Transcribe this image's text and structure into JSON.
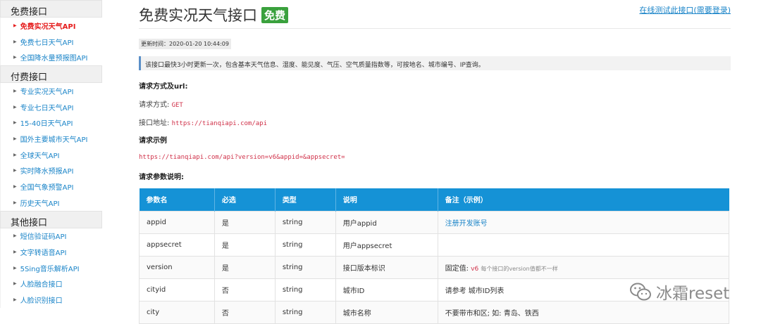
{
  "sidebar": {
    "groups": [
      {
        "title": "免费接口",
        "items": [
          "免费实况天气API",
          "免费七日天气API",
          "全国降水量预报图API"
        ]
      },
      {
        "title": "付费接口",
        "items": [
          "专业实况天气API",
          "专业七日天气API",
          "15-40日天气API",
          "国外主要城市天气API",
          "全球天气API",
          "实时降水预报API",
          "全国气象预警API",
          "历史天气API"
        ]
      },
      {
        "title": "其他接口",
        "items": [
          "短信验证码API",
          "文字转语音API",
          "5Sing音乐解析API",
          "人脸融合接口",
          "人脸识别接口"
        ]
      }
    ],
    "active_item": "免费实况天气API"
  },
  "page": {
    "title": "免费实况天气接口",
    "badge": "免费",
    "test_link": "在线测试此接口(需要登录)",
    "update_time": "更新时间：2020-01-20 10:44:09",
    "notice": "该接口最快3小时更新一次，包含基本天气信息、湿度、能见度、气压、空气质量指数等，可按地名、城市编号、IP查询。",
    "method_heading": "请求方式及url:",
    "method_label": "请求方式:",
    "method_value": "GET",
    "url_label": "接口地址:",
    "url_value": "https://tianqiapi.com/api",
    "example_heading": "请求示例",
    "example_url": "https://tianqiapi.com/api?version=v6&appid=&appsecret=",
    "params_heading": "请求参数说明:"
  },
  "table": {
    "headers": [
      "参数名",
      "必选",
      "类型",
      "说明",
      "备注（示例）"
    ],
    "rows": [
      {
        "name": "appid",
        "required": "是",
        "type": "string",
        "desc": "用户appid",
        "note": "注册开发账号"
      },
      {
        "name": "appsecret",
        "required": "是",
        "type": "string",
        "desc": "用户appsecret",
        "note": ""
      },
      {
        "name": "version",
        "required": "是",
        "type": "string",
        "desc": "接口版本标识",
        "note_prefix": "固定值:",
        "note_code": "v6",
        "note_rest": "每个接口的version值都不一样"
      },
      {
        "name": "cityid",
        "required": "否",
        "type": "string",
        "desc": "城市ID",
        "note": "请参考 城市ID列表"
      },
      {
        "name": "city",
        "required": "否",
        "type": "string",
        "desc": "城市名称",
        "note": "不要带市和区; 如: 青岛、铁西"
      }
    ]
  },
  "watermark": {
    "text": "冰霜reset",
    "icon": "wechat-icon"
  },
  "colors": {
    "link": "#1a84c8",
    "active": "#e51d1d",
    "table_header": "#1592d6",
    "badge": "#3aa13d",
    "code": "#d0324a"
  }
}
